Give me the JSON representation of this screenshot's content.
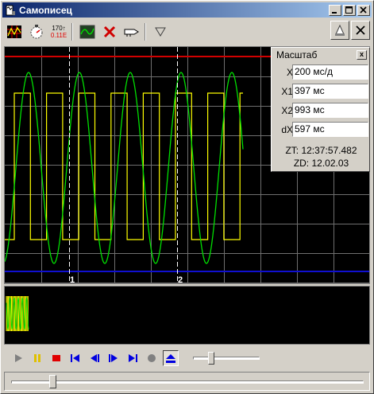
{
  "window": {
    "title": "Самописец",
    "min_label": "_",
    "max_label": "□",
    "close_label": "✕"
  },
  "toolbar": {
    "icons": [
      "grid-icon",
      "clock-dial-icon",
      "level-readout-icon",
      "waveform-icon",
      "delete-icon",
      "probe-icon",
      "trigger-icon"
    ],
    "level_top": "170↑",
    "level_bottom": "0.11E",
    "right_icons": [
      "print-icon",
      "close-plot-icon"
    ]
  },
  "plot": {
    "colors": {
      "background": "#000000",
      "grid": "#6f6f6f",
      "square_wave": "#ffff00",
      "sine_wave": "#00e000",
      "upper_limit": "#d00000",
      "lower_limit": "#1010d0",
      "marker": "#ffffff"
    },
    "markers": [
      {
        "label": "1"
      },
      {
        "label": "2"
      }
    ]
  },
  "scale_panel": {
    "title": "Масштаб",
    "close_label": "x",
    "rows": [
      {
        "label": "X",
        "value": "200 мс/д"
      },
      {
        "label": "X1",
        "value": "397 мс"
      },
      {
        "label": "X2",
        "value": "993 мс"
      },
      {
        "label": "dX",
        "value": "597 мс"
      }
    ],
    "zt": "ZT: 12:37:57.482",
    "zd": "ZD: 12.02.03"
  },
  "controls": {
    "buttons": [
      "play",
      "pause",
      "stop",
      "to-start",
      "step-back",
      "step-forward",
      "to-end",
      "record",
      "eject"
    ],
    "colors": {
      "play": "#808080",
      "pause": "#e0c000",
      "stop": "#e00000",
      "nav": "#0000e0",
      "record": "#808080"
    },
    "speed_position": 0.25,
    "scroll_position": 0.11
  }
}
